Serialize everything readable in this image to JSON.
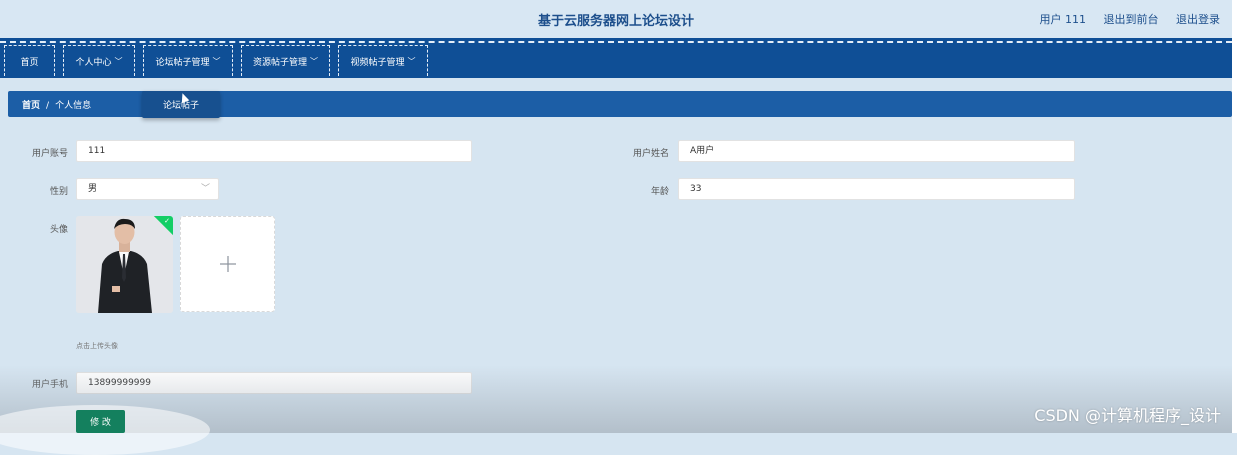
{
  "header": {
    "title": "基于云服务器网上论坛设计",
    "user_label": "用户 111",
    "front_link": "退出到前台",
    "logout_link": "退出登录"
  },
  "nav": {
    "home": "首页",
    "personal": "个人中心",
    "forum_posts": "论坛帖子管理",
    "resource_posts": "资源帖子管理",
    "video_posts": "视频帖子管理",
    "chevron": "﹀"
  },
  "dropdown": {
    "item": "论坛帖子"
  },
  "breadcrumb": {
    "home": "首页",
    "separator": "/",
    "current": "个人信息"
  },
  "form": {
    "account_label": "用户账号",
    "account_value": "111",
    "name_label": "用户姓名",
    "name_value": "A用户",
    "gender_label": "性别",
    "gender_value": "男",
    "age_label": "年龄",
    "age_value": "33",
    "avatar_label": "头像",
    "upload_hint": "点击上传头像",
    "phone_label": "用户手机",
    "phone_value": "13899999999",
    "submit": "修 改"
  },
  "watermark": "CSDN @计算机程序_设计",
  "icons": {
    "plus": "+",
    "check": "✓",
    "select_arrow": "﹀"
  },
  "colors": {
    "nav_bg": "#0f4f96",
    "crumb_bg": "#1c5ea6",
    "page_bg": "#d6e5f1",
    "button": "#14805e"
  }
}
